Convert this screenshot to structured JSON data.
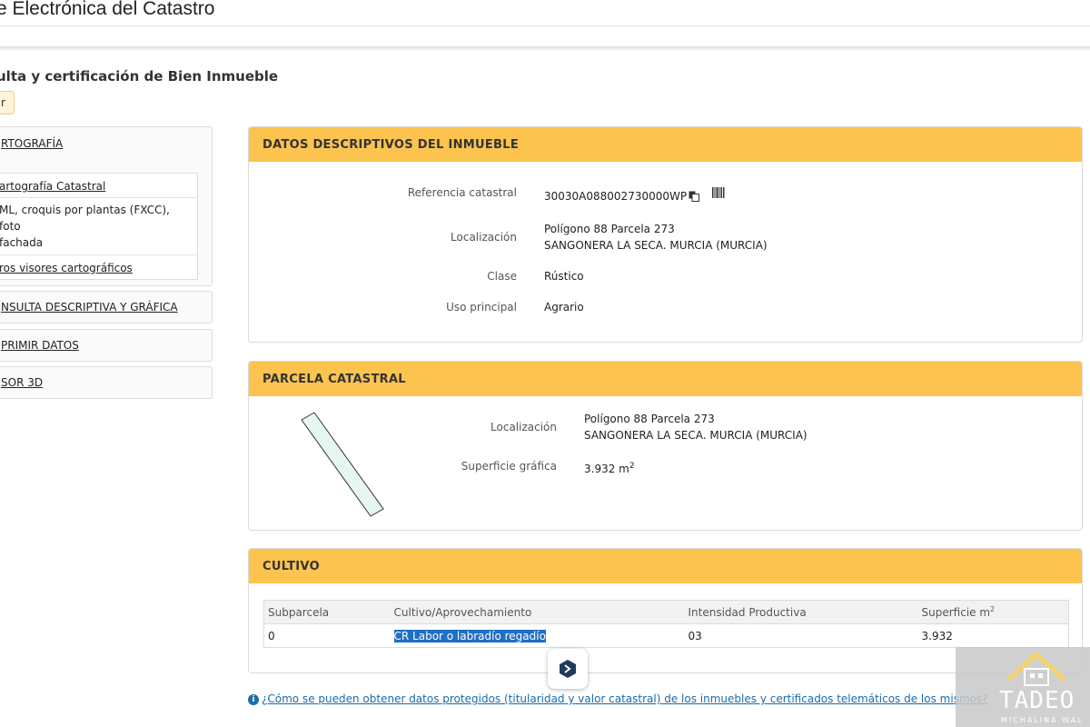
{
  "header": {
    "site_title": "e Electrónica del Catastro"
  },
  "page": {
    "heading": "ulta y certificación de Bien Inmueble",
    "back_label": "r"
  },
  "sidebar": {
    "sections": [
      {
        "label": "RTOGRAFÍA"
      },
      {
        "label": "NSULTA DESCRIPTIVA Y GRÁFICA"
      },
      {
        "label": "PRIMIR DATOS"
      },
      {
        "label": "SOR 3D"
      }
    ],
    "sub_items": [
      {
        "label": "artografía Catastral"
      },
      {
        "line1": "ML, croquis por plantas (FXCC), foto",
        "line2": " fachada"
      },
      {
        "label": "ros visores cartográficos"
      }
    ]
  },
  "datos": {
    "title": "DATOS DESCRIPTIVOS DEL INMUEBLE",
    "ref_label": "Referencia catastral",
    "ref_value": "30030A088002730000WP",
    "loc_label": "Localización",
    "loc_line1": "Polígono 88 Parcela 273",
    "loc_line2": "SANGONERA LA SECA. MURCIA (MURCIA)",
    "clase_label": "Clase",
    "clase_value": "Rústico",
    "uso_label": "Uso principal",
    "uso_value": "Agrario",
    "icons": [
      "copy-icon",
      "barcode-icon"
    ]
  },
  "parcela": {
    "title": "PARCELA CATASTRAL",
    "loc_label": "Localización",
    "loc_line1": "Polígono 88 Parcela 273",
    "loc_line2": "SANGONERA LA SECA. MURCIA (MURCIA)",
    "sup_label": "Superficie gráfica",
    "sup_value": "3.932 m",
    "sup_unit_exp": "2",
    "shape_fill": "#e6f7f1"
  },
  "cultivo": {
    "title": "CULTIVO",
    "headers": [
      "Subparcela",
      "Cultivo/Aprovechamiento",
      "Intensidad Productiva",
      "Superficie m"
    ],
    "header_exp": "2",
    "rows": [
      {
        "subparcela": "0",
        "cultivo": "CR Labor o labradío regadío",
        "intensidad": "03",
        "superficie": "3.932"
      }
    ]
  },
  "footer": {
    "info_icon": "info-icon",
    "link": "¿Cómo se pueden obtener datos protegidos (titularidad y valor catastral) de los inmuebles y certificados telemáticos de los mismos?"
  },
  "watermark": {
    "name": "TADEO HO",
    "sub": "MICHALINA WAL"
  },
  "colors": {
    "accent": "#fcc34f",
    "link": "#1b6ca8",
    "selection": "#1f6fc5"
  }
}
